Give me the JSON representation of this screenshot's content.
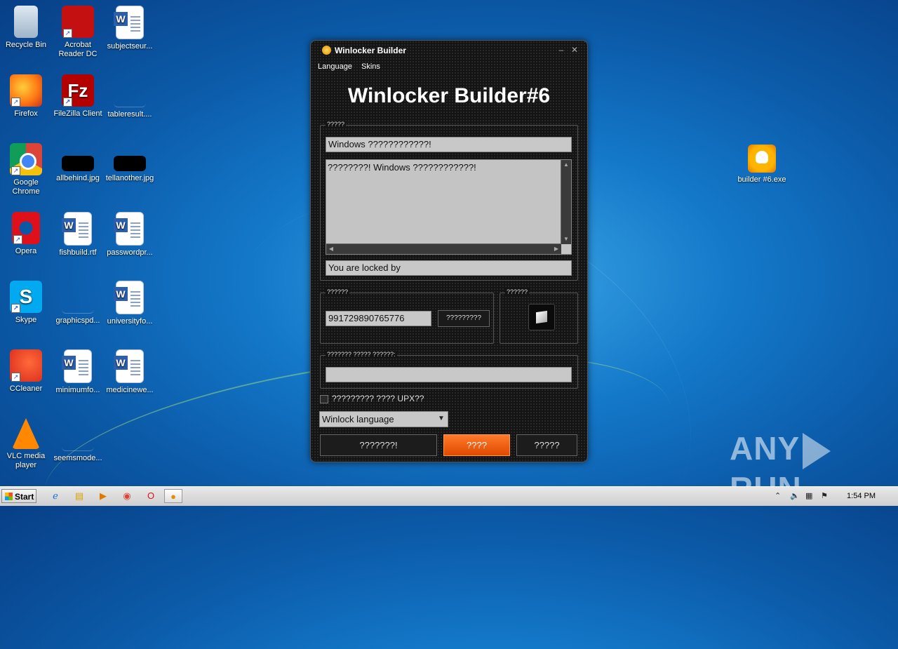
{
  "desktop": {
    "icons": [
      {
        "label": "Recycle Bin"
      },
      {
        "label": "Acrobat Reader DC"
      },
      {
        "label": "subjectseur..."
      },
      {
        "label": "Firefox"
      },
      {
        "label": "FileZilla Client"
      },
      {
        "label": "tableresult...."
      },
      {
        "label": "Google Chrome"
      },
      {
        "label": "allbehind.jpg"
      },
      {
        "label": "tellanother.jpg"
      },
      {
        "label": "Opera"
      },
      {
        "label": "fishbuild.rtf"
      },
      {
        "label": "passwordpr..."
      },
      {
        "label": "Skype"
      },
      {
        "label": "graphicspd..."
      },
      {
        "label": "universityfo..."
      },
      {
        "label": "CCleaner"
      },
      {
        "label": "minimumfo..."
      },
      {
        "label": "medicinewe..."
      },
      {
        "label": "VLC media player"
      },
      {
        "label": "seemsmode..."
      },
      {
        "label": "builder #6.exe"
      }
    ],
    "watermark": {
      "left": "ANY",
      "right": "RUN"
    }
  },
  "window": {
    "title": "Winlocker Builder",
    "minimize": "–",
    "close": "✕",
    "menu": [
      "Language",
      "Skins"
    ],
    "heading": "Winlocker Builder#6",
    "text_group": {
      "label": "?????",
      "title_field": "Windows ????????????!",
      "message": "????????! Windows ????????????!",
      "locked_by_field": "You are locked by"
    },
    "code_group": {
      "label": "??????",
      "code_field": "991729890765776",
      "generate_button": "?????????"
    },
    "icon_group": {
      "label": "??????"
    },
    "path_group": {
      "label": "??????? ????? ??????:",
      "path_field": ""
    },
    "upx_checkbox_label": "????????? ???? UPX??",
    "upx_checked": false,
    "language_select": "Winlock language",
    "buttons": {
      "left": "???????!",
      "middle": "????",
      "right": "?????"
    }
  },
  "taskbar": {
    "start_label": "Start",
    "apps": [
      "ie-icon",
      "explorer-icon",
      "media-player-icon",
      "chrome-icon",
      "opera-icon",
      "winlocker-icon"
    ],
    "clock": "1:54 PM",
    "colors": {
      "accent": "#ff6a1a"
    }
  }
}
